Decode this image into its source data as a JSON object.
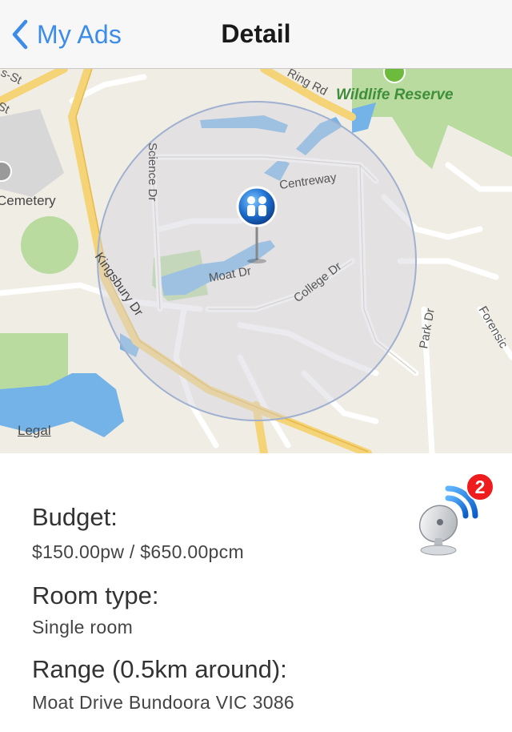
{
  "navbar": {
    "back_label": "My Ads",
    "title": "Detail"
  },
  "map": {
    "labels": {
      "ring_rd": "Ring Rd",
      "wildlife_reserve": "Wildlife Reserve",
      "cemetery": "Cemetery",
      "science_dr": "Science Dr",
      "centreway": "Centreway",
      "moat_dr": "Moat Dr",
      "kingsbury_dr": "Kingsbury Dr",
      "college_dr": "College Dr",
      "park_dr": "Park Dr",
      "forensic": "Forensic",
      "st_partial": "s-St",
      "st_partial2": "St"
    },
    "legal": "Legal"
  },
  "details": {
    "budget_label": "Budget:",
    "budget_value": "$150.00pw / $650.00pcm",
    "room_type_label": "Room type:",
    "room_type_value": "Single room",
    "range_label": "Range (0.5km around):",
    "range_value": "Moat Drive Bundoora VIC 3086"
  },
  "broadcast": {
    "icon": "satellite-dish-icon",
    "badge_count": "2"
  },
  "colors": {
    "accent": "#3d8ce8",
    "badge": "#ee1c1c",
    "map_water": "#74b3e8",
    "map_park": "#b9dba0",
    "map_road_major": "#f5d478"
  }
}
